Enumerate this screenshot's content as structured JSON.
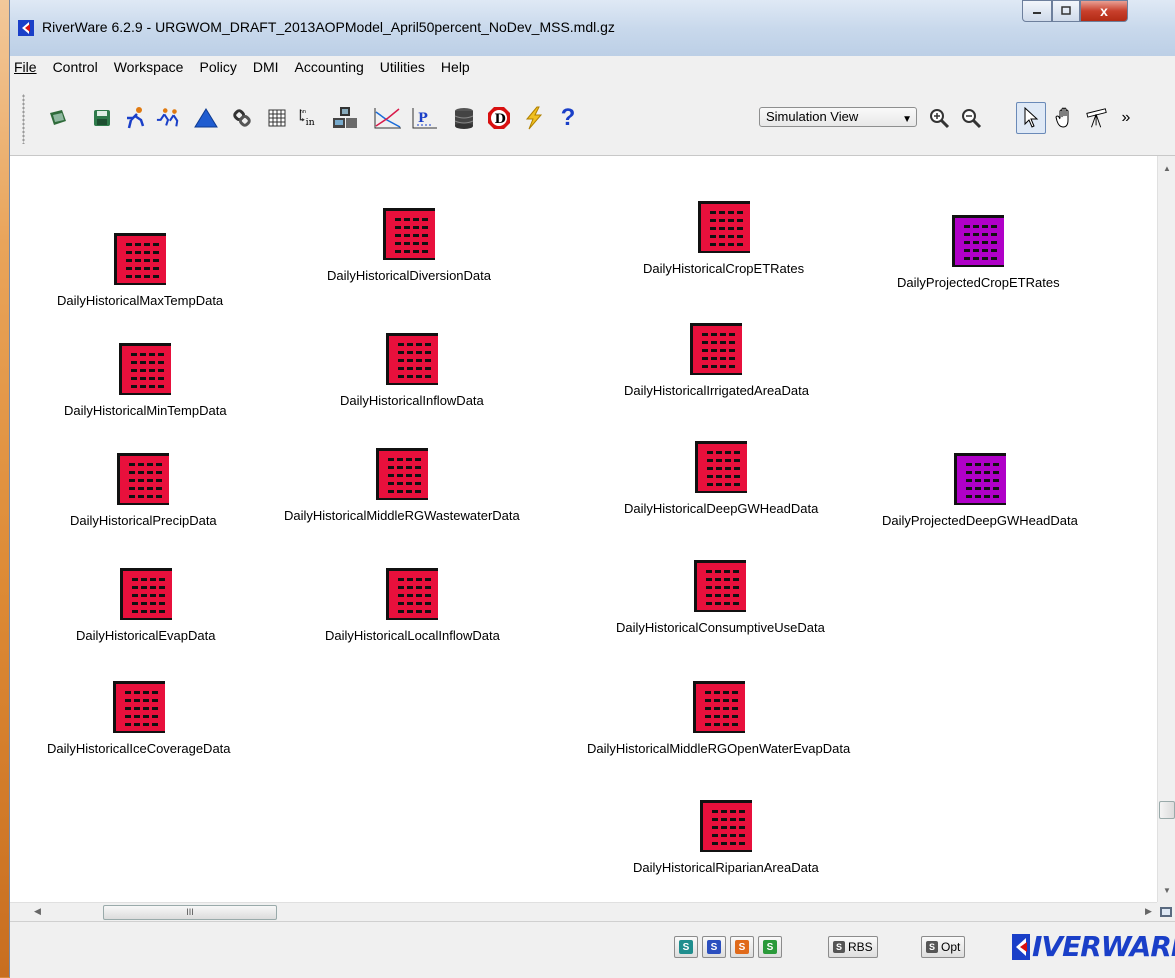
{
  "window": {
    "title": "RiverWare 6.2.9 - URGWOM_DRAFT_2013AOPModel_April50percent_NoDev_MSS.mdl.gz",
    "close_label": "x"
  },
  "menu": [
    {
      "label": "File"
    },
    {
      "label": "Control"
    },
    {
      "label": "Workspace"
    },
    {
      "label": "Policy"
    },
    {
      "label": "DMI"
    },
    {
      "label": "Accounting"
    },
    {
      "label": "Utilities"
    },
    {
      "label": "Help"
    }
  ],
  "toolbar": {
    "view_select": "Simulation View",
    "tools": [
      "open-icon",
      "save-icon",
      "run-icon",
      "run-all-icon",
      "triangle-icon",
      "link-icon",
      "grid-icon",
      "input-icon",
      "computer-icon",
      "plot-icon",
      "parse-icon",
      "database-icon",
      "diagnostics-icon",
      "lightning-icon",
      "help-icon",
      "zoom-in-icon",
      "zoom-out-icon",
      "pointer-icon",
      "hand-icon",
      "telescope-icon"
    ],
    "overflow": "»"
  },
  "colors": {
    "historical_icon": "#e8103c",
    "projected_icon": "#b000c8",
    "logo_blue": "#1a3fc8"
  },
  "workspace": {
    "objects": [
      {
        "label": "DailyHistoricalMaxTempData",
        "kind": "historical"
      },
      {
        "label": "DailyHistoricalMinTempData",
        "kind": "historical"
      },
      {
        "label": "DailyHistoricalPrecipData",
        "kind": "historical"
      },
      {
        "label": "DailyHistoricalEvapData",
        "kind": "historical"
      },
      {
        "label": "DailyHistoricalIceCoverageData",
        "kind": "historical"
      },
      {
        "label": "DailyHistoricalDiversionData",
        "kind": "historical"
      },
      {
        "label": "DailyHistoricalInflowData",
        "kind": "historical"
      },
      {
        "label": "DailyHistoricalMiddleRGWastewaterData",
        "kind": "historical"
      },
      {
        "label": "DailyHistoricalLocalInflowData",
        "kind": "historical"
      },
      {
        "label": "DailyHistoricalCropETRates",
        "kind": "historical"
      },
      {
        "label": "DailyHistoricalIrrigatedAreaData",
        "kind": "historical"
      },
      {
        "label": "DailyHistoricalDeepGWHeadData",
        "kind": "historical"
      },
      {
        "label": "DailyHistoricalConsumptiveUseData",
        "kind": "historical"
      },
      {
        "label": "DailyHistoricalMiddleRGOpenWaterEvapData",
        "kind": "historical"
      },
      {
        "label": "DailyHistoricalRiparianAreaData",
        "kind": "historical"
      },
      {
        "label": "DailyProjectedCropETRates",
        "kind": "projected"
      },
      {
        "label": "DailyProjectedDeepGWHeadData",
        "kind": "projected"
      }
    ]
  },
  "hscroll": {
    "thumb_label": "III"
  },
  "status": {
    "s_buttons": [
      {
        "label": "S",
        "color": "#1f8e8e"
      },
      {
        "label": "S",
        "color": "#2b4fbf"
      },
      {
        "label": "S",
        "color": "#e06a1a"
      },
      {
        "label": "S",
        "color": "#2a9a3a"
      }
    ],
    "rbs_label": "RBS",
    "opt_label": "Opt",
    "logo_text": "IVERWARE"
  }
}
